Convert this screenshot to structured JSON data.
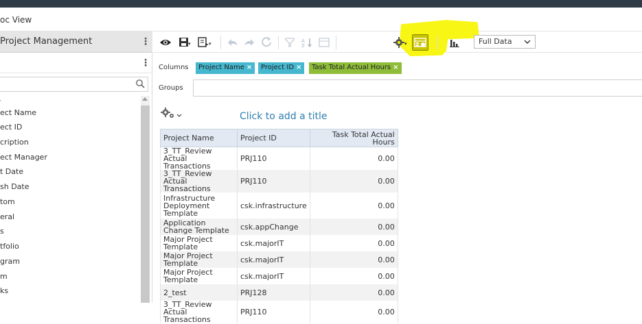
{
  "topbar": {
    "title": ""
  },
  "header": {
    "title": "oc View"
  },
  "sidebar": {
    "title": "Project Management",
    "search_placeholder": "",
    "fields": [
      "ect Name",
      "ect ID",
      "cription",
      "ect Manager",
      "t Date",
      "sh Date",
      "tom",
      "eral",
      "s",
      "tfolio",
      "gram",
      "m",
      "ks"
    ]
  },
  "toolbar": {
    "icons": [
      "eye-icon",
      "save-icon",
      "export-icon",
      "undo-icon",
      "redo-icon",
      "refresh-icon",
      "filter-icon",
      "sort-icon",
      "calculator-icon",
      "gear-icon",
      "report-toggle-icon",
      "chart-icon"
    ],
    "view_select": "Full Data"
  },
  "columns": {
    "label": "Columns",
    "pills": [
      {
        "label": "Project Name",
        "color": "#45b8cf"
      },
      {
        "label": "Project ID",
        "color": "#45b8cf"
      },
      {
        "label": "Task Total Actual Hours",
        "color": "#8fbd3a"
      }
    ]
  },
  "groups": {
    "label": "Groups"
  },
  "report": {
    "title": "Click to add a title",
    "headers": [
      "Project Name",
      "Project ID",
      "Task Total Actual Hours"
    ],
    "rows": [
      [
        "3_TT_Review Actual Transactions",
        "PRJ110",
        "0.00"
      ],
      [
        "3_TT_Review Actual Transactions",
        "PRJ110",
        "0.00"
      ],
      [
        "Infrastructure Deployment Template",
        "csk.infrastructure",
        "0.00"
      ],
      [
        "Application Change Template",
        "csk.appChange",
        "0.00"
      ],
      [
        "Major Project Template",
        "csk.majorIT",
        "0.00"
      ],
      [
        "Major Project Template",
        "csk.majorIT",
        "0.00"
      ],
      [
        "Major Project Template",
        "csk.majorIT",
        "0.00"
      ],
      [
        "2_test",
        "PRJ128",
        "0.00"
      ],
      [
        "3_TT_Review Actual Transactions",
        "PRJ110",
        "0.00"
      ]
    ]
  },
  "colors": {
    "highlight": "#f7f500",
    "accent": "#2f7fb0",
    "topbar": "#2f3b47"
  }
}
